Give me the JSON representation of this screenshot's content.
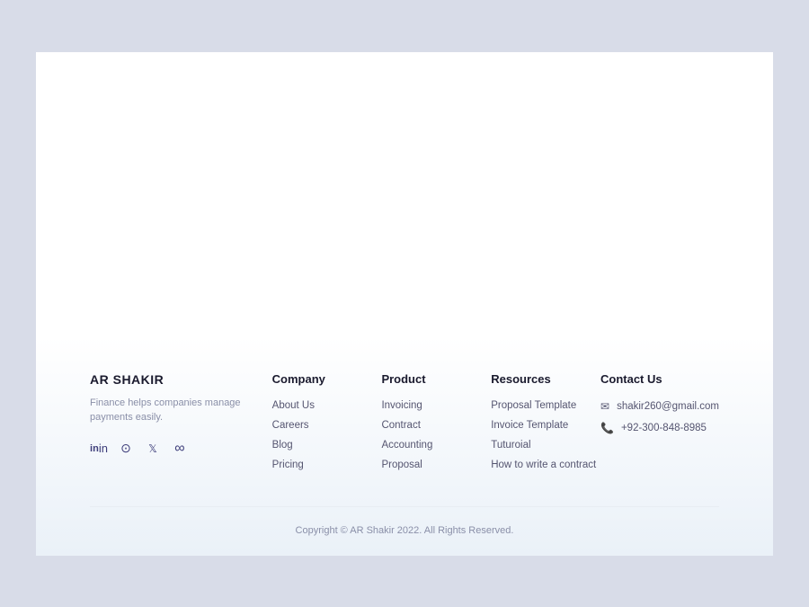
{
  "brand": {
    "name": "AR SHAKIR",
    "description": "Finance helps companies manage payments easily.",
    "social": [
      {
        "id": "linkedin",
        "symbol": "in",
        "label": "LinkedIn"
      },
      {
        "id": "messenger",
        "symbol": "⊙",
        "label": "Messenger"
      },
      {
        "id": "twitter",
        "symbol": "🐦",
        "label": "Twitter"
      },
      {
        "id": "infinite",
        "symbol": "∞",
        "label": "Infinite"
      }
    ]
  },
  "columns": {
    "company": {
      "title": "Company",
      "links": [
        "About Us",
        "Careers",
        "Blog",
        "Pricing"
      ]
    },
    "product": {
      "title": "Product",
      "links": [
        "Invoicing",
        "Contract",
        "Accounting",
        "Proposal"
      ]
    },
    "resources": {
      "title": "Resources",
      "links": [
        "Proposal Template",
        "Invoice Template",
        "Tuturoial",
        "How to write a contract"
      ]
    },
    "contact": {
      "title": "Contact Us",
      "email": "shakir260@gmail.com",
      "phone": "+92-300-848-8985"
    }
  },
  "footer": {
    "copyright": "Copyright © AR Shakir 2022. All Rights Reserved."
  }
}
